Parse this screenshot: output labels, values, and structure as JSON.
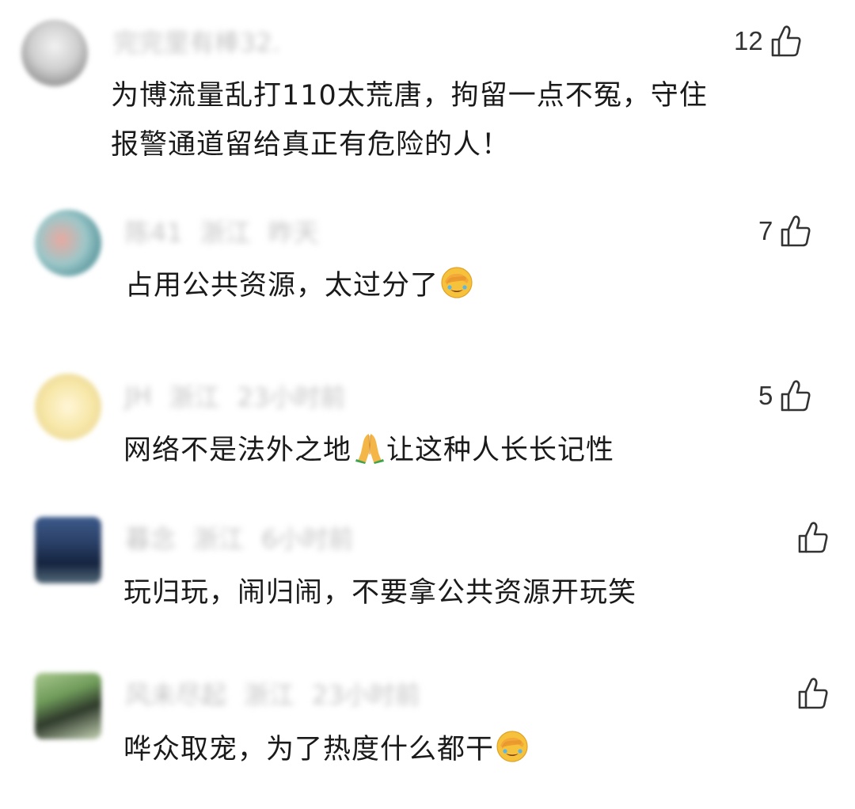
{
  "comments": [
    {
      "username": "完完里有棒32.",
      "location": "",
      "time": "",
      "likes": "12",
      "text_line1": "为博流量乱打110太荒唐，拘留一点不冤，守住",
      "text_line2": "报警通道留给真正有危险的人！"
    },
    {
      "username": "陈41",
      "location": "浙江",
      "time": "昨天",
      "likes": "7",
      "text": "占用公共资源，太过分了"
    },
    {
      "username": "JH",
      "location": "浙江",
      "time": "23小时前",
      "likes": "5",
      "text_before": "网络不是法外之地",
      "text_after": "让这种人长长记性"
    },
    {
      "username": "暮念",
      "location": "浙江",
      "time": "6小时前",
      "likes": "",
      "text": "玩归玩，闹归闹，不要拿公共资源开玩笑"
    },
    {
      "username": "风未尽起",
      "location": "浙江",
      "time": "23小时前",
      "likes": "",
      "text": "哗众取宠，为了热度什么都干"
    }
  ],
  "icons": {
    "like": "thumbs-up-outline-icon",
    "face_palm": "facepalm-emoji-icon",
    "pray": "folded-hands-emoji-icon"
  },
  "colors": {
    "text": "#1a1a1a",
    "meta": "#c4c4c4",
    "icon": "#333333",
    "emoji_face": "#f7c23b"
  }
}
